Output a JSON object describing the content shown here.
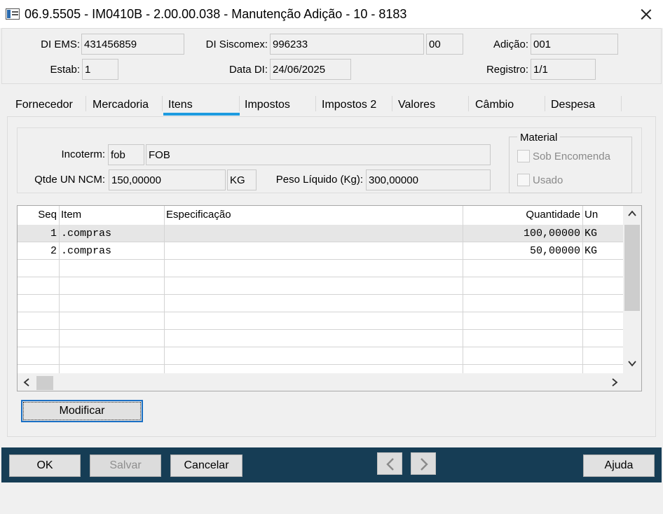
{
  "window": {
    "title": "06.9.5505 - IM0410B - 2.00.00.038 - Manutenção Adição - 10 - 8183"
  },
  "header": {
    "di_ems_label": "DI EMS:",
    "di_ems_value": "431456859",
    "di_siscomex_label": "DI Siscomex:",
    "di_siscomex_value": "996233",
    "di_siscomex_suffix": "00",
    "adicao_label": "Adição:",
    "adicao_value": "001",
    "estab_label": "Estab:",
    "estab_value": "1",
    "data_di_label": "Data DI:",
    "data_di_value": "24/06/2025",
    "registro_label": "Registro:",
    "registro_value": "1/1"
  },
  "tabs": [
    {
      "label": "Fornecedor"
    },
    {
      "label": "Mercadoria"
    },
    {
      "label": "Itens",
      "selected": true
    },
    {
      "label": "Impostos"
    },
    {
      "label": "Impostos 2"
    },
    {
      "label": "Valores"
    },
    {
      "label": "Câmbio"
    },
    {
      "label": "Despesa"
    }
  ],
  "itens": {
    "incoterm_label": "Incoterm:",
    "incoterm_code": "fob",
    "incoterm_desc": "FOB",
    "qtde_label": "Qtde UN NCM:",
    "qtde_value": "150,00000",
    "qtde_unit": "KG",
    "peso_label": "Peso Líquido (Kg):",
    "peso_value": "300,00000",
    "material_title": "Material",
    "sob_encomenda_label": "Sob Encomenda",
    "usado_label": "Usado"
  },
  "grid": {
    "headers": {
      "seq": "Seq",
      "item": "Item",
      "especificacao": "Especificação",
      "quantidade": "Quantidade",
      "un": "Un"
    },
    "rows": [
      {
        "seq": "1",
        "item": ".compras",
        "especificacao": "",
        "quantidade": "100,00000",
        "un": "KG"
      },
      {
        "seq": "2",
        "item": ".compras",
        "especificacao": "",
        "quantidade": "50,00000",
        "un": "KG"
      }
    ]
  },
  "buttons": {
    "modificar": "Modificar",
    "ok": "OK",
    "salvar": "Salvar",
    "cancelar": "Cancelar",
    "ajuda": "Ajuda"
  },
  "icons": {
    "window_icon": "app-window-icon",
    "close": "close-icon",
    "prev": "chevron-left-icon",
    "next": "chevron-right-icon",
    "scroll_up": "chevron-up-icon",
    "scroll_down": "chevron-down-icon",
    "scroll_left": "chevron-left-icon",
    "scroll_right": "chevron-right-icon"
  },
  "colors": {
    "tab_selected_accent": "#1e9be0",
    "footer_bar": "#163d55",
    "focus_border": "#1a6fc4"
  }
}
